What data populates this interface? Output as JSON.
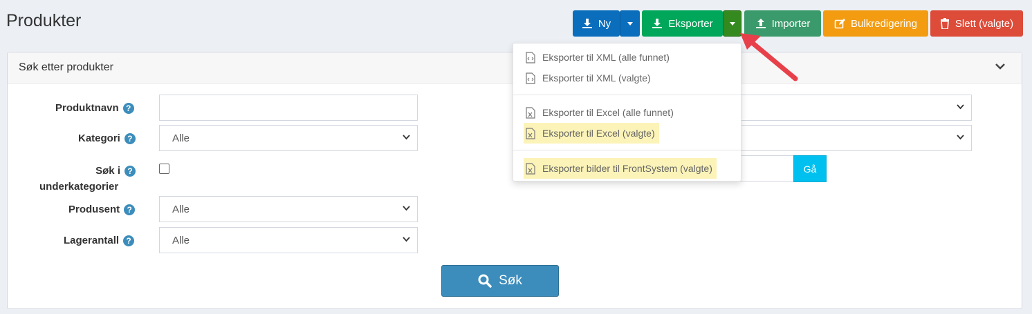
{
  "page": {
    "title": "Produkter"
  },
  "toolbar": {
    "new_label": "Ny",
    "export_label": "Eksporter",
    "import_label": "Importer",
    "bulk_label": "Bulkredigering",
    "delete_label": "Slett (valgte)"
  },
  "colors": {
    "primary": "#0a6ebd",
    "export": "#00a65a",
    "export_caret": "#358a1f",
    "import": "#3b9a6b",
    "bulk": "#f39c12",
    "delete": "#dd4b39",
    "search": "#3c8dbc",
    "info": "#00c0ef"
  },
  "export_menu": {
    "items": [
      {
        "label": "Eksporter til XML (alle funnet)",
        "icon": "xml-file-icon"
      },
      {
        "label": "Eksporter til XML (valgte)",
        "icon": "xml-file-icon"
      },
      {
        "label": "Eksporter til Excel (alle funnet)",
        "icon": "excel-file-icon"
      },
      {
        "label": "Eksporter til Excel (valgte)",
        "icon": "excel-file-icon"
      },
      {
        "label": "Eksporter bilder til FrontSystem (valgte)",
        "icon": "excel-file-icon"
      }
    ]
  },
  "search_panel": {
    "title": "Søk etter produkter",
    "fields": {
      "product_name": {
        "label": "Produktnavn",
        "value": ""
      },
      "category": {
        "label": "Kategori",
        "value": "Alle"
      },
      "subcategories": {
        "label_line1": "Søk i",
        "label_line2": "underkategorier",
        "checked": false
      },
      "manufacturer": {
        "label": "Produsent",
        "value": "Alle"
      },
      "stock": {
        "label": "Lagerantall",
        "value": "Alle"
      }
    },
    "go_label": "Gå",
    "search_label": "Søk"
  }
}
